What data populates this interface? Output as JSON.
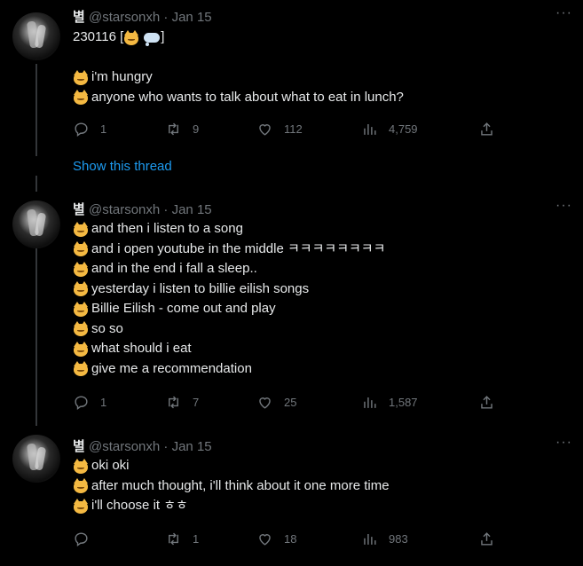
{
  "user": {
    "name": "별",
    "handle": "@starsonxh",
    "date": "Jan 15",
    "separator": "·"
  },
  "more_label": "···",
  "show_thread": "Show this thread",
  "tweets": [
    {
      "first_line_prefix": "230116 [",
      "first_line_suffix": "]",
      "lines": [
        "i'm hungry",
        "anyone who wants to talk about what to eat in lunch?"
      ],
      "stats": {
        "replies": "1",
        "retweets": "9",
        "likes": "112",
        "views": "4,759"
      }
    },
    {
      "lines": [
        "and then i listen to a song",
        "and i open youtube in the middle ㅋㅋㅋㅋㅋㅋㅋㅋ",
        "and in the end i fall a sleep..",
        "yesterday i listen to billie eilish songs",
        "Billie Eilish - come out and play",
        "so so",
        "what should i eat",
        "give me a recommendation"
      ],
      "stats": {
        "replies": "1",
        "retweets": "7",
        "likes": "25",
        "views": "1,587"
      }
    },
    {
      "lines": [
        "oki oki",
        "after much thought, i'll think about it one more time",
        "i'll choose it ㅎㅎ"
      ],
      "stats": {
        "replies": "",
        "retweets": "1",
        "likes": "18",
        "views": "983"
      }
    }
  ],
  "icons": {
    "reply": "reply-icon",
    "retweet": "retweet-icon",
    "like": "heart-icon",
    "views": "views-icon",
    "share": "share-icon",
    "more": "more-icon"
  },
  "colors": {
    "background": "#000000",
    "text": "#e7e9ea",
    "muted": "#71767b",
    "link": "#1d9bf0",
    "thread_line": "#333639"
  }
}
